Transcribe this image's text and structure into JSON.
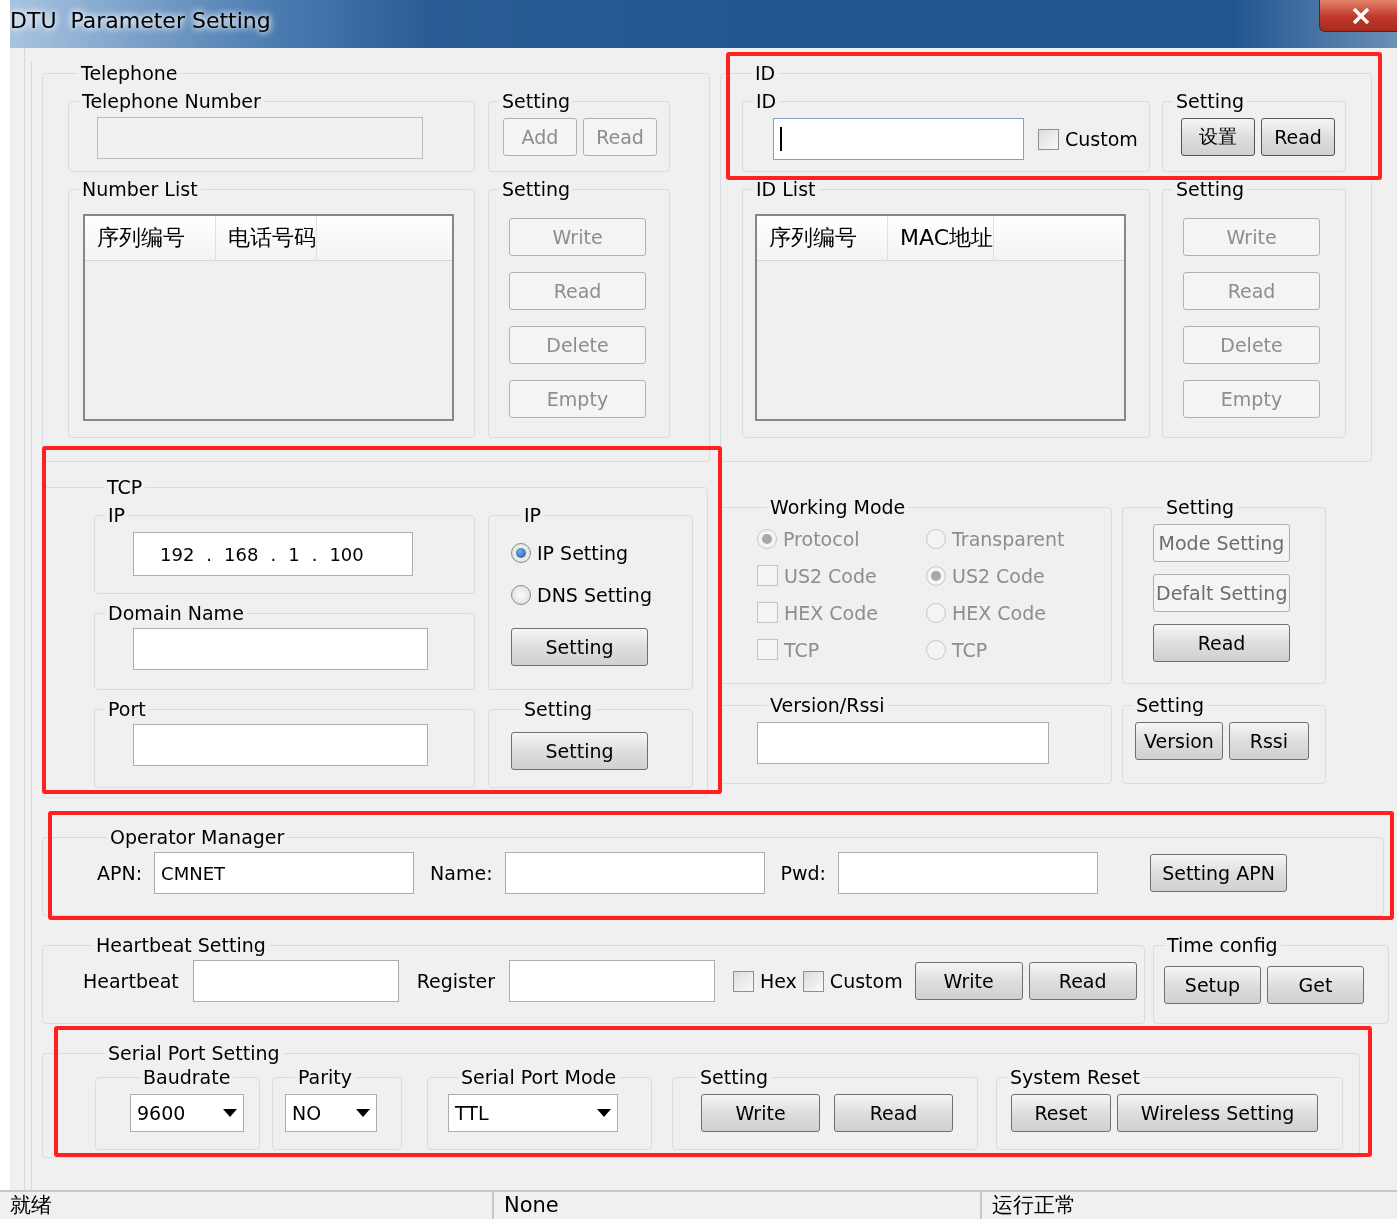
{
  "window": {
    "title": "DTU  Parameter Setting"
  },
  "telephone": {
    "title": "Telephone",
    "number": {
      "title": "Telephone Number",
      "disabled": true
    },
    "number_setting": {
      "title": "Setting",
      "buttons": [
        {
          "label": "Add",
          "disabled": true
        },
        {
          "label": "Read",
          "disabled": true
        }
      ]
    },
    "list": {
      "title": "Number List",
      "columns": [
        "序列编号",
        "电话号码"
      ]
    },
    "list_setting": {
      "title": "Setting",
      "buttons": [
        {
          "label": "Write",
          "disabled": true
        },
        {
          "label": "Read",
          "disabled": true
        },
        {
          "label": "Delete",
          "disabled": true
        },
        {
          "label": "Empty",
          "disabled": true
        }
      ]
    }
  },
  "id": {
    "title": "ID",
    "id_field": {
      "title": "ID",
      "custom": {
        "label": "Custom",
        "checked": false
      }
    },
    "id_setting": {
      "title": "Setting",
      "buttons": [
        {
          "label": "设置",
          "disabled": false
        },
        {
          "label": "Read",
          "disabled": false
        }
      ]
    },
    "list": {
      "title": "ID List",
      "columns": [
        "序列编号",
        "MAC地址"
      ]
    },
    "list_setting": {
      "title": "Setting",
      "buttons": [
        {
          "label": "Write",
          "disabled": true
        },
        {
          "label": "Read",
          "disabled": true
        },
        {
          "label": "Delete",
          "disabled": true
        },
        {
          "label": "Empty",
          "disabled": true
        }
      ]
    }
  },
  "tcp": {
    "title": "TCP",
    "ip": {
      "title": "IP",
      "octets": [
        "192",
        "168",
        "1",
        "100"
      ],
      "separator": "."
    },
    "ip_mode": {
      "title": "IP",
      "options": [
        {
          "label": "IP Setting",
          "selected": true
        },
        {
          "label": "DNS Setting",
          "selected": false
        }
      ],
      "button": "Setting"
    },
    "domain": {
      "title": "Domain Name"
    },
    "port": {
      "title": "Port"
    },
    "port_setting": {
      "title": "Setting",
      "button": "Setting"
    }
  },
  "working_mode": {
    "title": "Working Mode",
    "disabled": true,
    "columns": [
      [
        {
          "kind": "radio",
          "label": "Protocol",
          "selected": true
        },
        {
          "kind": "checkbox",
          "label": "US2 Code",
          "checked": false
        },
        {
          "kind": "checkbox",
          "label": "HEX Code",
          "checked": false
        },
        {
          "kind": "checkbox",
          "label": "TCP",
          "checked": false
        }
      ],
      [
        {
          "kind": "radio",
          "label": "Transparent",
          "selected": false
        },
        {
          "kind": "radio",
          "label": "US2 Code",
          "selected": true
        },
        {
          "kind": "radio",
          "label": "HEX Code",
          "selected": false
        },
        {
          "kind": "radio",
          "label": "TCP",
          "selected": false
        }
      ]
    ]
  },
  "mode_setting": {
    "title": "Setting",
    "buttons": [
      {
        "label": "Mode Setting",
        "disabled": true
      },
      {
        "label": "Defalt Setting",
        "disabled": true
      },
      {
        "label": "Read",
        "disabled": false
      }
    ]
  },
  "version": {
    "title": "Version/Rssi"
  },
  "version_setting": {
    "title": "Setting",
    "buttons": [
      "Version",
      "Rssi"
    ]
  },
  "operator": {
    "title": "Operator Manager",
    "fields": [
      {
        "label": "APN:",
        "value": "CMNET"
      },
      {
        "label": "Name:"
      },
      {
        "label": "Pwd:"
      }
    ],
    "button": "Setting APN"
  },
  "heartbeat": {
    "title": "Heartbeat Setting",
    "fields": [
      {
        "label": "Heartbeat"
      },
      {
        "label": "Register"
      }
    ],
    "checks": [
      {
        "label": "Hex",
        "checked": false
      },
      {
        "label": "Custom",
        "checked": false
      }
    ],
    "buttons": [
      "Write",
      "Read"
    ]
  },
  "time_config": {
    "title": "Time config",
    "buttons": [
      "Setup",
      "Get"
    ]
  },
  "serial": {
    "title": "Serial Port Setting",
    "selects": [
      {
        "title": "Baudrate",
        "value": "9600"
      },
      {
        "title": "Parity",
        "value": "NO"
      },
      {
        "title": "Serial Port Mode",
        "value": "TTL"
      }
    ],
    "setting": {
      "title": "Setting",
      "buttons": [
        "Write",
        "Read"
      ]
    },
    "reset": {
      "title": "System Reset",
      "buttons": [
        "Reset",
        "Wireless Setting"
      ]
    }
  },
  "status_bar": [
    "就绪",
    "None",
    "运行正常"
  ]
}
